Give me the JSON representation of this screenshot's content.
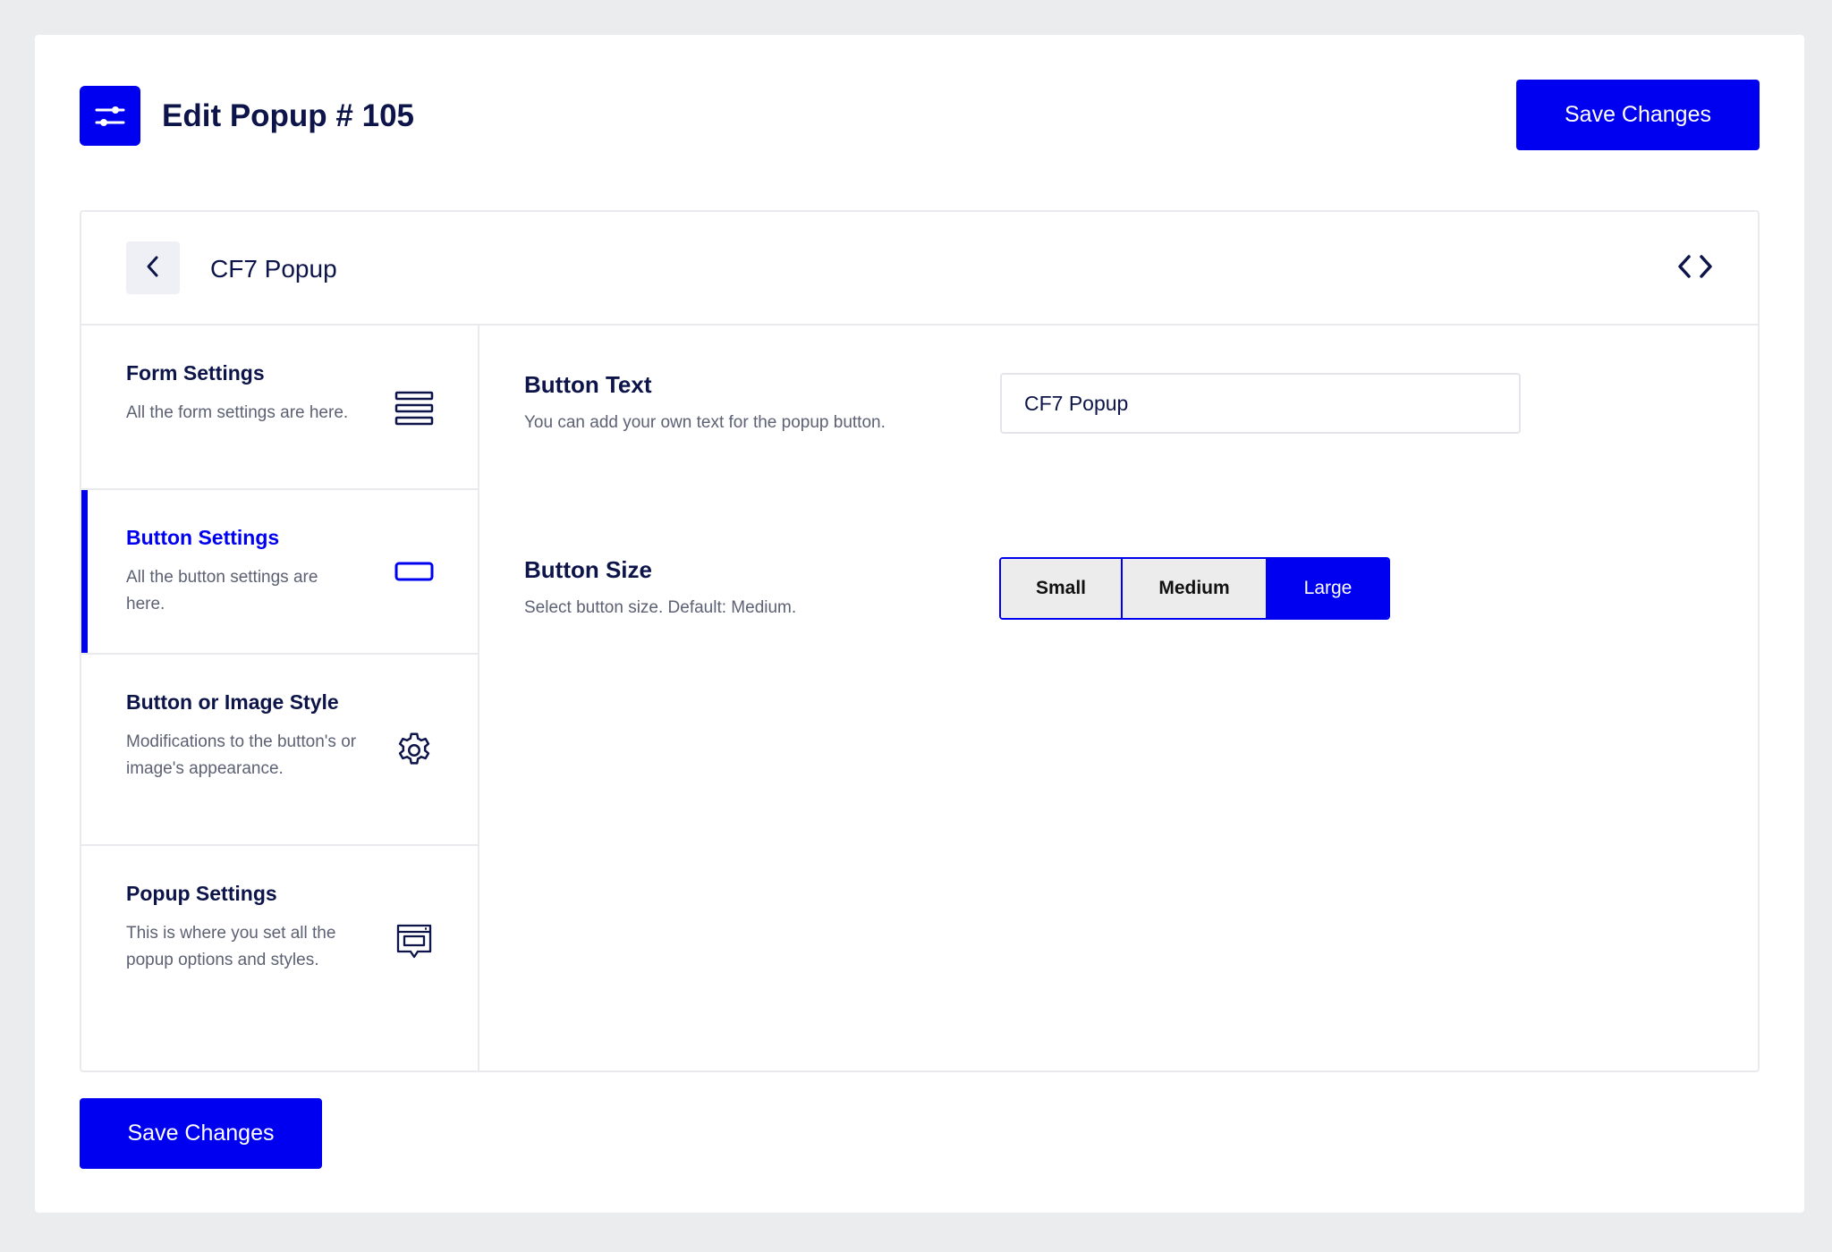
{
  "header": {
    "title": "Edit Popup # 105",
    "save_label": "Save Changes",
    "icon": "sliders-icon"
  },
  "card": {
    "title": "CF7 Popup",
    "back_icon": "chevron-left-icon",
    "code_icon": "code-icon"
  },
  "sidebar": {
    "items": [
      {
        "title": "Form Settings",
        "desc": "All the form settings are here.",
        "icon": "form-lines-icon",
        "active": false
      },
      {
        "title": "Button Settings",
        "desc": "All the button settings are here.",
        "icon": "button-outline-icon",
        "active": true
      },
      {
        "title": "Button or Image Style",
        "desc": "Modifications to the button's or image's appearance.",
        "icon": "gear-icon",
        "active": false
      },
      {
        "title": "Popup Settings",
        "desc": "This is where you set all the popup options and styles.",
        "icon": "popup-window-icon",
        "active": false
      }
    ]
  },
  "content": {
    "button_text": {
      "title": "Button Text",
      "desc": "You can add your own text for the popup button.",
      "value": "CF7 Popup"
    },
    "button_size": {
      "title": "Button Size",
      "desc": "Select button size. Default: Medium.",
      "options": [
        "Small",
        "Medium",
        "Large"
      ],
      "selected": "Large"
    }
  },
  "footer": {
    "save_label": "Save Changes"
  },
  "colors": {
    "accent": "#0000f0",
    "text": "#0c1449",
    "muted": "#5c6173",
    "border": "#e9eaee"
  }
}
